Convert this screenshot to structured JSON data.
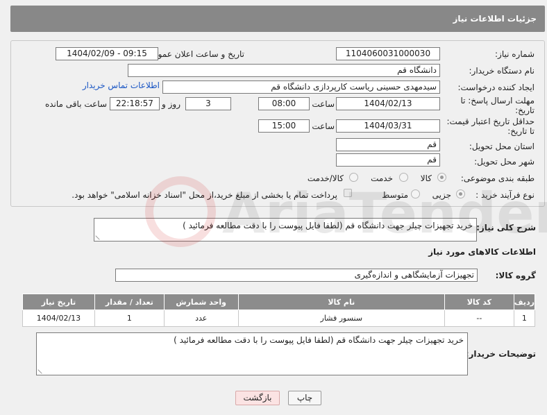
{
  "header": {
    "title": "جزئیات اطلاعات نیاز"
  },
  "form": {
    "need_number_label": "شماره نیاز:",
    "need_number": "1104060031000030",
    "announce_label": "تاریخ و ساعت اعلان عمومی:",
    "announce_value": "1404/02/09 - 09:15",
    "buyer_org_label": "نام دستگاه خریدار:",
    "buyer_org": "دانشگاه قم",
    "creator_label": "ایجاد کننده درخواست:",
    "creator": "سیدمهدی حسینی ریاست کارپردازی دانشگاه قم",
    "contact_link": "اطلاعات تماس خریدار",
    "deadline_label_1": "مهلت ارسال پاسخ: تا",
    "deadline_label_2": "تاریخ:",
    "deadline_date": "1404/02/13",
    "time_label": "ساعت",
    "deadline_time": "08:00",
    "days_value": "3",
    "days_label": "روز و",
    "remaining_value": "22:18:57",
    "remaining_label": "ساعت باقی مانده",
    "validity_label_1": "حداقل تاریخ اعتبار قیمت:",
    "validity_label_2": "تا تاریخ:",
    "validity_date": "1404/03/31",
    "validity_time": "15:00",
    "province_label": "استان محل تحویل:",
    "province": "قم",
    "city_label": "شهر محل تحویل:",
    "city": "قم",
    "category_label": "طبقه بندی موضوعی:",
    "category_options": [
      "کالا",
      "خدمت",
      "کالا/خدمت"
    ],
    "process_label": "نوع فرآیند خرید :",
    "process_options": [
      "جزیی",
      "متوسط"
    ],
    "payment_note": "پرداخت تمام یا بخشی از مبلغ خرید،از محل \"اسناد خزانه اسلامی\" خواهد بود."
  },
  "summary": {
    "label": "شرح کلی نیاز:",
    "text": "خرید تجهیزات چیلر جهت دانشگاه قم (لطفا فایل پیوست را با دقت مطالعه فرمائید )"
  },
  "goods": {
    "section_title": "اطلاعات کالاهای مورد نیاز",
    "group_label": "گروه کالا:",
    "group_value": "تجهیزات آزمایشگاهی و اندازه‌گیری",
    "columns": [
      "ردیف",
      "کد کالا",
      "نام کالا",
      "واحد شمارش",
      "تعداد / مقدار",
      "تاریخ نیاز"
    ],
    "rows": [
      [
        "1",
        "--",
        "سنسور فشار",
        "عدد",
        "1",
        "1404/02/13"
      ]
    ]
  },
  "buyer_notes": {
    "label": "توضیحات خریدار:",
    "text": "خرید تجهیزات چیلر جهت دانشگاه قم (لطفا فایل پیوست را با دقت مطالعه فرمائید )"
  },
  "buttons": {
    "print": "چاپ",
    "back": "بازگشت"
  },
  "watermark": {
    "text": "AriaTender.net"
  }
}
